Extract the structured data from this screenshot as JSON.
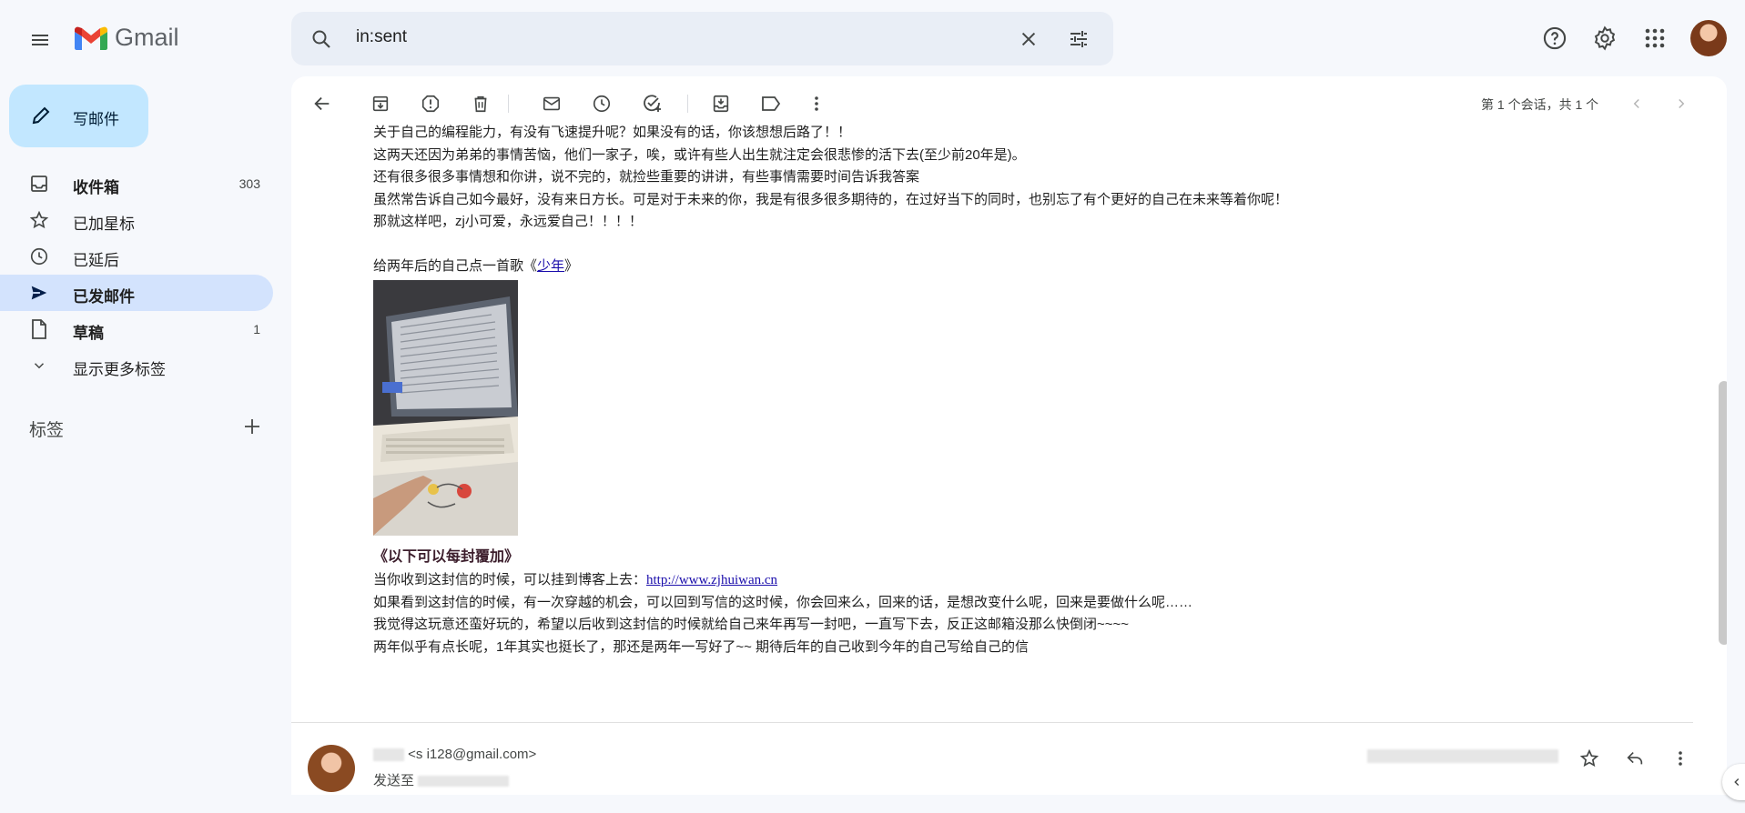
{
  "app": {
    "name": "Gmail"
  },
  "search": {
    "query": "in:sent"
  },
  "compose": {
    "label": "写邮件"
  },
  "nav": {
    "items": [
      {
        "label": "收件箱",
        "count": "303"
      },
      {
        "label": "已加星标",
        "count": ""
      },
      {
        "label": "已延后",
        "count": ""
      },
      {
        "label": "已发邮件",
        "count": ""
      },
      {
        "label": "草稿",
        "count": "1"
      },
      {
        "label": "显示更多标签",
        "count": ""
      }
    ],
    "labels_header": "标签"
  },
  "toolbar": {
    "pager": "第 1 个会话，共 1 个"
  },
  "message": {
    "lines": [
      "关于自己的编程能力，有没有飞速提升呢？如果没有的话，你该想想后路了！！",
      "这两天还因为弟弟的事情苦恼，他们一家子，唉，或许有些人出生就注定会很悲惨的活下去(至少前20年是)。",
      "还有很多很多事情想和你讲，说不完的，就捡些重要的讲讲，有些事情需要时间告诉我答案",
      "虽然常告诉自己如今最好，没有来日方长。可是对于未来的你，我是有很多很多期待的，在过好当下的同时，也别忘了有个更好的自己在未来等着你呢！",
      "那就这样吧，zj小可爱，永远爱自己！！！！"
    ],
    "song_prefix": "给两年后的自己点一首歌《",
    "song_link": "少年",
    "song_suffix": "》",
    "section_title": "《以下可以每封覆加》",
    "blog_prefix": "当你收到这封信的时候，可以挂到博客上去：",
    "blog_link": "http://www.zjhuiwan.cn",
    "after_lines": [
      "如果看到这封信的时候，有一次穿越的机会，可以回到写信的这时候，你会回来么，回来的话，是想改变什么呢，回来是要做什么呢……",
      "我觉得这玩意还蛮好玩的，希望以后收到这封信的时候就给自己来年再写一封吧，一直写下去，反正这邮箱没那么快倒闭~~~~",
      "两年似乎有点长呢，1年其实也挺长了，那还是两年一写好了~~   期待后年的自己收到今年的自己写给自己的信"
    ]
  },
  "message2": {
    "from_visible": "<s      i128@gmail.com>",
    "to_label": "发送至"
  }
}
